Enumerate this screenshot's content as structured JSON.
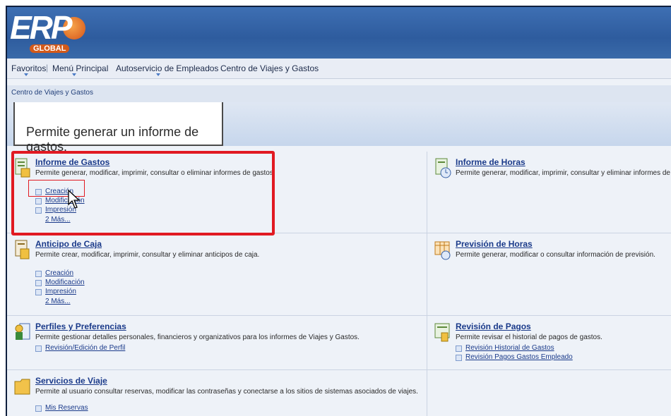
{
  "logo": {
    "text": "ERP",
    "subtext": "GLOBAL"
  },
  "nav": {
    "items": [
      {
        "label": "Favoritos"
      },
      {
        "label": "Menú Principal"
      },
      {
        "label": "Autoservicio de Empleados"
      },
      {
        "label": "Centro de Viajes y Gastos"
      }
    ],
    "separators": [
      "›",
      "›",
      "›"
    ]
  },
  "breadcrumb": "Centro de Viajes y Gastos",
  "tooltip": "Permite generar un informe de gastos.",
  "tiles": {
    "informe_gastos": {
      "title": "Informe de Gastos",
      "description": "Permite generar, modificar, imprimir, consultar o eliminar informes de gastos.",
      "links": [
        "Creación",
        "Modificación",
        "Impresión"
      ],
      "more": "2 Más..."
    },
    "informe_horas": {
      "title": "Informe de Horas",
      "description": "Permite generar, modificar, imprimir, consultar y eliminar informes de horas."
    },
    "anticipo_caja": {
      "title": "Anticipo de Caja",
      "description": "Permite crear, modificar, imprimir, consultar y eliminar anticipos de caja.",
      "links": [
        "Creación",
        "Modificación",
        "Impresión"
      ],
      "more": "2 Más..."
    },
    "prevision_horas": {
      "title": "Previsión de Horas",
      "description": "Permite generar, modificar o consultar información de previsión."
    },
    "perfiles": {
      "title": "Perfiles y Preferencias",
      "description": "Permite gestionar detalles personales, financieros y organizativos para los informes de Viajes y Gastos.",
      "links": [
        "Revisión/Edición de Perfil"
      ]
    },
    "revision_pagos": {
      "title": "Revisión de Pagos",
      "description": "Permite revisar el historial de pagos de gastos.",
      "links": [
        "Revisión Historial de Gastos",
        "Revisión Pagos Gastos Empleado"
      ]
    },
    "servicios_viaje": {
      "title": "Servicios de Viaje",
      "description": "Permite al usuario consultar reservas, modificar las contraseñas y conectarse a los sitios de sistemas asociados de viajes.",
      "links": [
        "Mis Reservas"
      ]
    }
  },
  "colors": {
    "banner": "#2e5c9e",
    "link": "#1a3a8a",
    "highlight": "#e11a22"
  }
}
